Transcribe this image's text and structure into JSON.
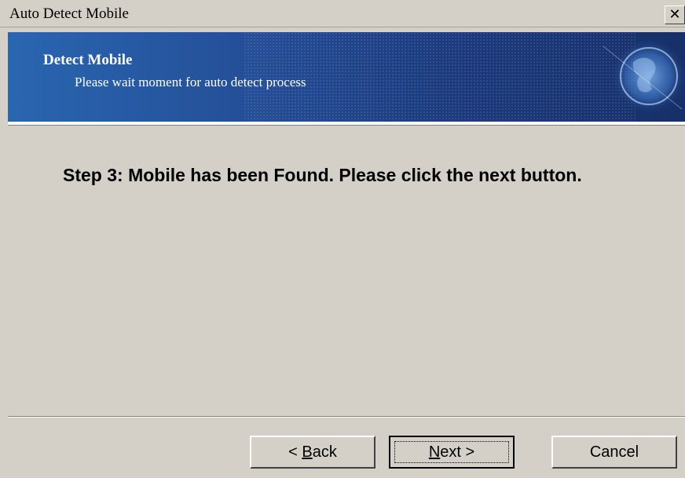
{
  "window": {
    "title": "Auto Detect Mobile",
    "close_label": "✕"
  },
  "banner": {
    "title": "Detect Mobile",
    "subtitle": "Please wait moment for auto detect process"
  },
  "content": {
    "message": "Step 3: Mobile has been Found. Please click the next button."
  },
  "buttons": {
    "back": {
      "prefix": "< ",
      "accel": "B",
      "rest": "ack"
    },
    "next": {
      "accel": "N",
      "rest": "ext >"
    },
    "cancel": "Cancel"
  }
}
